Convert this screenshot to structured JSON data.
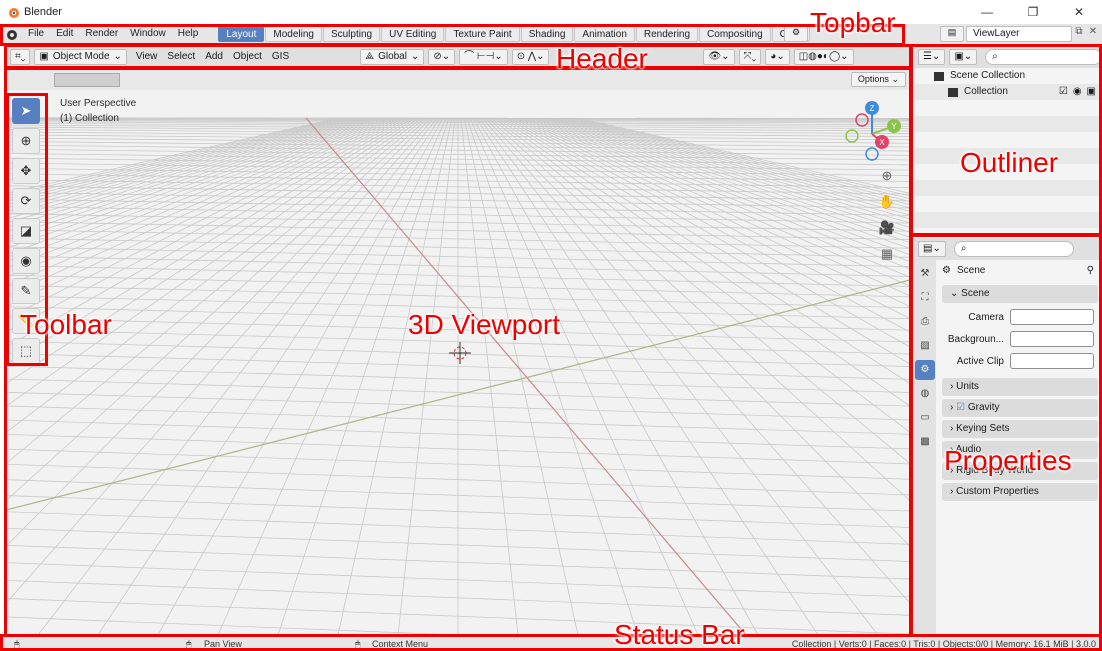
{
  "window": {
    "title": "Blender",
    "minimize": "—",
    "maximize": "❐",
    "close": "✕"
  },
  "topbar": {
    "menus": [
      "File",
      "Edit",
      "Render",
      "Window",
      "Help"
    ],
    "workspaces": [
      "Layout",
      "Modeling",
      "Sculpting",
      "UV Editing",
      "Texture Paint",
      "Shading",
      "Animation",
      "Rendering",
      "Compositing",
      "Geor"
    ],
    "active_workspace": "Layout",
    "view_layer": "ViewLayer"
  },
  "header": {
    "mode": "Object Mode",
    "menus": [
      "View",
      "Select",
      "Add",
      "Object",
      "GIS"
    ],
    "transform_orientation": "Global"
  },
  "viewport": {
    "options_label": "Options",
    "perspective": "User Perspective",
    "collection": "(1) Collection",
    "gizmo_axes": [
      "Z",
      "Y",
      "X"
    ]
  },
  "outliner": {
    "scene_collection": "Scene Collection",
    "collection": "Collection"
  },
  "properties": {
    "context": "Scene",
    "panel_scene": "Scene",
    "fields": [
      "Camera",
      "Backgroun...",
      "Active Clip"
    ],
    "panels": [
      "Units",
      "Gravity",
      "Keying Sets",
      "Audio",
      "Rigid Body World",
      "Custom Properties"
    ]
  },
  "statusbar": {
    "pan": "Pan View",
    "context_menu": "Context Menu",
    "stats": "Collection | Verts:0 | Faces:0 | Tris:0 | Objects:0/0 | Memory: 16.1 MiB | 3.0.0"
  },
  "annotations": {
    "topbar": "Topbar",
    "header": "Header",
    "outliner": "Outliner",
    "toolbar": "Toolbar",
    "viewport": "3D Viewport",
    "properties": "Properties",
    "statusbar": "Status Bar"
  },
  "colors": {
    "annotation": "#ee0000",
    "active_blue": "#5680c2",
    "x_axis": "#e0446a",
    "y_axis": "#8bc34a",
    "z_axis": "#3d8be0"
  }
}
